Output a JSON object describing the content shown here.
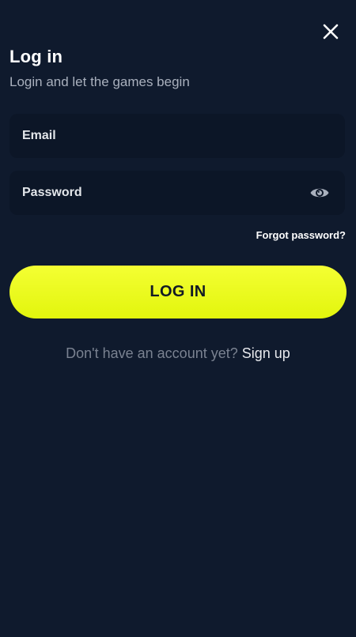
{
  "header": {
    "title": "Log in",
    "subtitle": "Login and let the games begin",
    "close_icon": "close-icon"
  },
  "form": {
    "email_label": "Email",
    "password_label": "Password",
    "password_toggle_icon": "eye-icon",
    "forgot_password": "Forgot password?",
    "submit_label": "LOG IN"
  },
  "footer": {
    "prompt": "Don't have an account yet?",
    "signup_link": "Sign up"
  },
  "colors": {
    "background": "#0f1a2d",
    "field_background": "#0c1627",
    "accent": "#e9fb16",
    "muted_text": "#7a8291"
  }
}
